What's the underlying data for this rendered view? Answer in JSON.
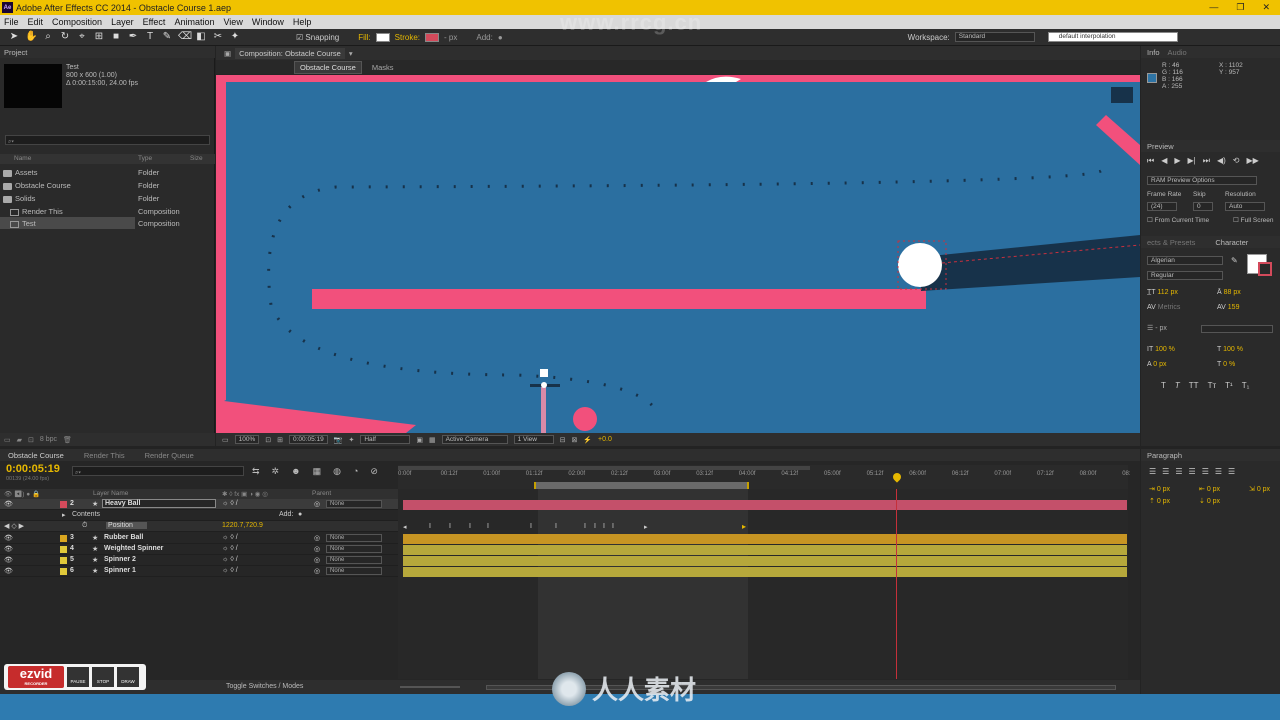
{
  "window": {
    "title": "Adobe After Effects CC 2014 - Obstacle Course 1.aep",
    "controls": [
      "—",
      "❐",
      "✕"
    ]
  },
  "menu": [
    "File",
    "Edit",
    "Composition",
    "Layer",
    "Effect",
    "Animation",
    "View",
    "Window",
    "Help"
  ],
  "toolbar": {
    "snapping": "Snapping",
    "fill": "Fill:",
    "stroke": "Stroke:",
    "px": "- px",
    "add": "Add:",
    "workspace_label": "Workspace:",
    "workspace_value": "Standard",
    "search_placeholder": "default interpolation"
  },
  "watermark_top": "www.rrcg.cn",
  "project": {
    "tab": "Project",
    "item_name": "Test",
    "item_size": "800 x 600 (1.00)",
    "item_duration": "Δ 0:00:15:00, 24.00 fps",
    "columns": {
      "name": "Name",
      "type": "Type",
      "size": "Size"
    },
    "items": [
      {
        "name": "Assets",
        "type": "Folder",
        "kind": "folder"
      },
      {
        "name": "Obstacle Course",
        "type": "Folder",
        "kind": "folder"
      },
      {
        "name": "Solids",
        "type": "Folder",
        "kind": "folder"
      },
      {
        "name": "Render This",
        "type": "Composition",
        "kind": "comp"
      },
      {
        "name": "Test",
        "type": "Composition",
        "kind": "comp",
        "selected": true
      }
    ],
    "bpc": "8 bpc"
  },
  "composition": {
    "tab": "Composition: Obstacle Course",
    "crumbs": [
      "Obstacle Course",
      "Masks"
    ],
    "footer": {
      "zoom": "100%",
      "time": "0:00:05:19",
      "resolution": "Half",
      "camera": "Active Camera",
      "view": "1 View",
      "exposure": "+0.0"
    }
  },
  "info": {
    "tabs": [
      "Info",
      "Audio"
    ],
    "R": "R : 46",
    "G": "G : 116",
    "B": "B : 166",
    "A": "A : 255",
    "X": "X : 1102",
    "Y": "Y : 957",
    "color": "#2e74a6"
  },
  "preview": {
    "tab": "Preview",
    "ram_options": "RAM Preview Options",
    "frame_rate_label": "Frame Rate",
    "skip_label": "Skip",
    "resolution_label": "Resolution",
    "frame_rate": "(24)",
    "skip": "0",
    "resolution": "Auto",
    "from_current": "From Current Time",
    "full_screen": "Full Screen"
  },
  "character": {
    "tabs": [
      "ects & Presets",
      "Character"
    ],
    "font": "Algerian",
    "style": "Regular",
    "size": "112 px",
    "leading": "88 px",
    "kerning": "Metrics",
    "tracking": "159",
    "stroke_width": "- px",
    "vscale": "100 %",
    "hscale": "100 %",
    "baseline": "0 px",
    "tsume": "0 %"
  },
  "timeline": {
    "tabs": [
      "Obstacle Course",
      "Render This",
      "Render Queue"
    ],
    "timecode": "0:00:05:19",
    "fps_note": "00139 (24.00 fps)",
    "header": {
      "layer_name": "Layer Name",
      "parent": "Parent"
    },
    "ruler_labels": [
      "0:00f",
      "00:12f",
      "01:00f",
      "01:12f",
      "02:00f",
      "02:12f",
      "03:00f",
      "03:12f",
      "04:00f",
      "04:12f",
      "05:00f",
      "05:12f",
      "06:00f",
      "06:12f",
      "07:00f",
      "07:12f",
      "08:00f",
      "08:"
    ],
    "layers": [
      {
        "num": "2",
        "name": "Heavy Ball",
        "parent": "None",
        "color": "#d34a5b",
        "selected": true
      },
      {
        "num": "3",
        "name": "Rubber Ball",
        "parent": "None",
        "color": "#d9a620"
      },
      {
        "num": "4",
        "name": "Weighted Spinner",
        "parent": "None",
        "color": "#e0c93a"
      },
      {
        "num": "5",
        "name": "Spinner 2",
        "parent": "None",
        "color": "#e0c93a"
      },
      {
        "num": "6",
        "name": "Spinner 1",
        "parent": "None",
        "color": "#e0c93a"
      }
    ],
    "contents_label": "Contents",
    "add_label": "Add:",
    "position_label": "Position",
    "position_value": "1220.7,720.9",
    "toggle": "Toggle Switches / Modes"
  },
  "paragraph": {
    "tab": "Paragraph",
    "fields": [
      "0 px",
      "0 px",
      "0 px",
      "0 px",
      "0 px"
    ]
  },
  "ezvid": {
    "brand": "ezvid",
    "sub": "RECORDER",
    "buttons": [
      "PAUSE",
      "STOP",
      "DRAW"
    ]
  },
  "watermark_bottom": "人人素材"
}
